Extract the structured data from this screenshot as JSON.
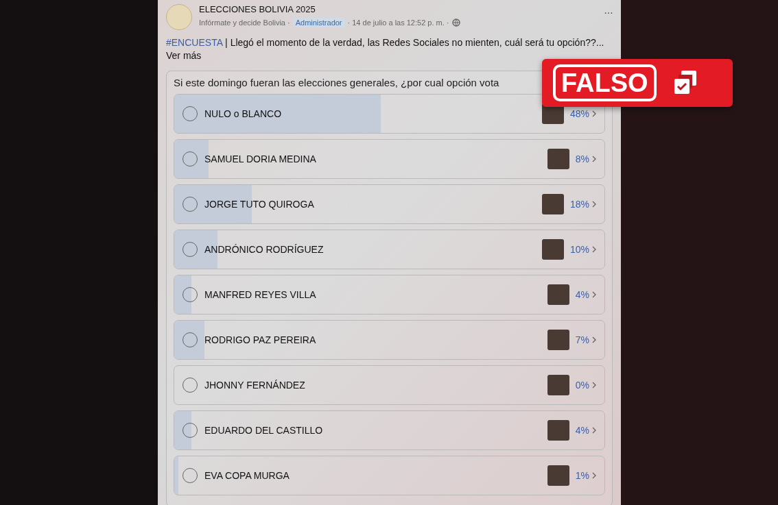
{
  "post": {
    "page_name": "ELECCIONES BOLIVIA 2025",
    "group": "Infórmate y decide Bolivia ·",
    "role_badge": "Administrador",
    "date": "· 14 de julio a las 12:52 p. m. ·",
    "more_menu": "···",
    "hashtag": "#ENCUESTA",
    "text": "| Llegó el momento de la verdad, las Redes Sociales no mienten, cuál será tu opción??...",
    "see_more": "Ver más"
  },
  "poll": {
    "question": "Si este domingo fueran las elecciones generales, ¿por cual opción vota",
    "options": [
      {
        "label": "NULO o BLANCO",
        "percent": "48%",
        "level": 0.48,
        "selected": false
      },
      {
        "label": "SAMUEL DORIA MEDINA",
        "percent": "8%",
        "level": 0.08,
        "selected": false
      },
      {
        "label": "JORGE TUTO QUIROGA",
        "percent": "18%",
        "level": 0.18,
        "selected": false
      },
      {
        "label": "ANDRÓNICO RODRÍGUEZ",
        "percent": "10%",
        "level": 0.1,
        "selected": false
      },
      {
        "label": "MANFRED REYES VILLA",
        "percent": "4%",
        "level": 0.04,
        "selected": false
      },
      {
        "label": "RODRIGO PAZ PEREIRA",
        "percent": "7%",
        "level": 0.07,
        "selected": false
      },
      {
        "label": "JHONNY FERNÁNDEZ",
        "percent": "0%",
        "level": 0.0,
        "selected": false
      },
      {
        "label": "EDUARDO DEL CASTILLO",
        "percent": "4%",
        "level": 0.04,
        "selected": false
      },
      {
        "label": "EVA COPA MURGA",
        "percent": "1%",
        "level": 0.01,
        "selected": false
      }
    ]
  },
  "verdict": {
    "label": "FALSO"
  }
}
